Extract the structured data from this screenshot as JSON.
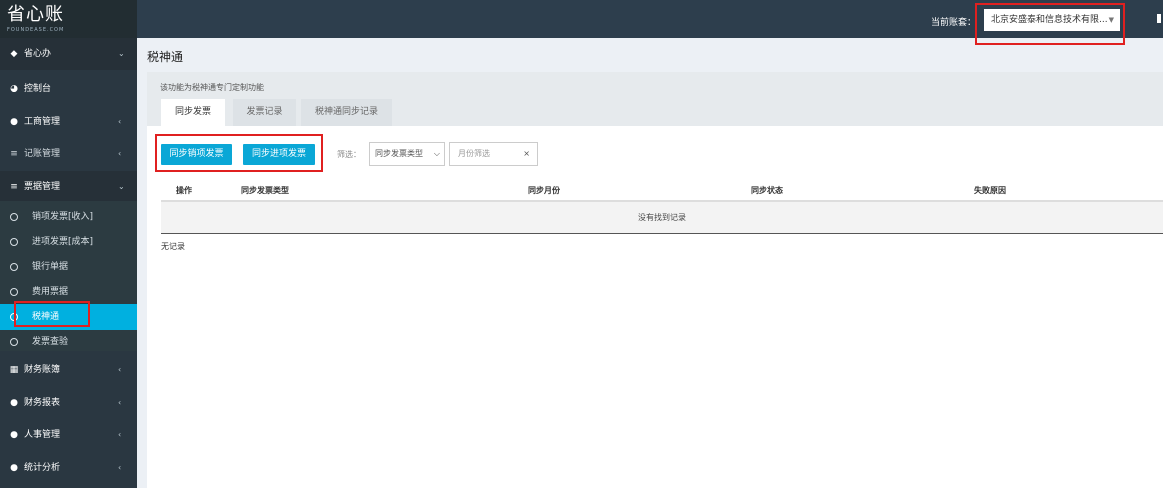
{
  "header": {
    "logo_text": "省心账",
    "logo_sub": "FOUNDEASE.COM",
    "account_label": "当前账套：",
    "account_value": "北京安盛泰和信息技术有限..."
  },
  "sidebar": {
    "items": [
      {
        "label": "省心办",
        "icon": "diamond-icon",
        "chevron": "⌄"
      },
      {
        "label": "控制台",
        "icon": "dashboard-icon"
      },
      {
        "label": "工商管理",
        "icon": "circle-badge-icon",
        "chevron": "‹"
      },
      {
        "label": "记账管理",
        "icon": "list-icon",
        "chevron": "‹"
      },
      {
        "label": "票据管理",
        "icon": "list-icon",
        "chevron": "⌄"
      },
      {
        "label": "财务账簿",
        "icon": "grid-icon",
        "chevron": "‹"
      },
      {
        "label": "财务报表",
        "icon": "circle-badge-icon",
        "chevron": "‹"
      },
      {
        "label": "人事管理",
        "icon": "circle-badge-icon",
        "chevron": "‹"
      },
      {
        "label": "统计分析",
        "icon": "circle-badge-icon",
        "chevron": "‹"
      }
    ],
    "sub_items": [
      {
        "label": "销项发票[收入]"
      },
      {
        "label": "进项发票[成本]"
      },
      {
        "label": "银行单据"
      },
      {
        "label": "费用票据"
      },
      {
        "label": "税神通",
        "active": true
      },
      {
        "label": "发票查验"
      }
    ]
  },
  "main": {
    "title": "税神通",
    "description": "该功能为税神通专门定制功能",
    "tabs": [
      {
        "label": "同步发票",
        "active": true
      },
      {
        "label": "发票记录"
      },
      {
        "label": "税神通同步记录"
      }
    ],
    "buttons": {
      "sync_sales": "同步销项发票",
      "sync_purchase": "同步进项发票"
    },
    "filter": {
      "label": "筛选：",
      "type_select": "同步发票类型",
      "month_placeholder": "月份筛选",
      "clear": "×"
    },
    "table": {
      "columns": [
        "操作",
        "同步发票类型",
        "同步月份",
        "同步状态",
        "失败原因"
      ],
      "empty_message": "没有找到记录"
    },
    "footer_note": "无记录"
  },
  "colors": {
    "topbar": "#2d3e4d",
    "sidebar": "#2a3741",
    "accent": "#0aa7d6",
    "highlight": "#e02020"
  }
}
